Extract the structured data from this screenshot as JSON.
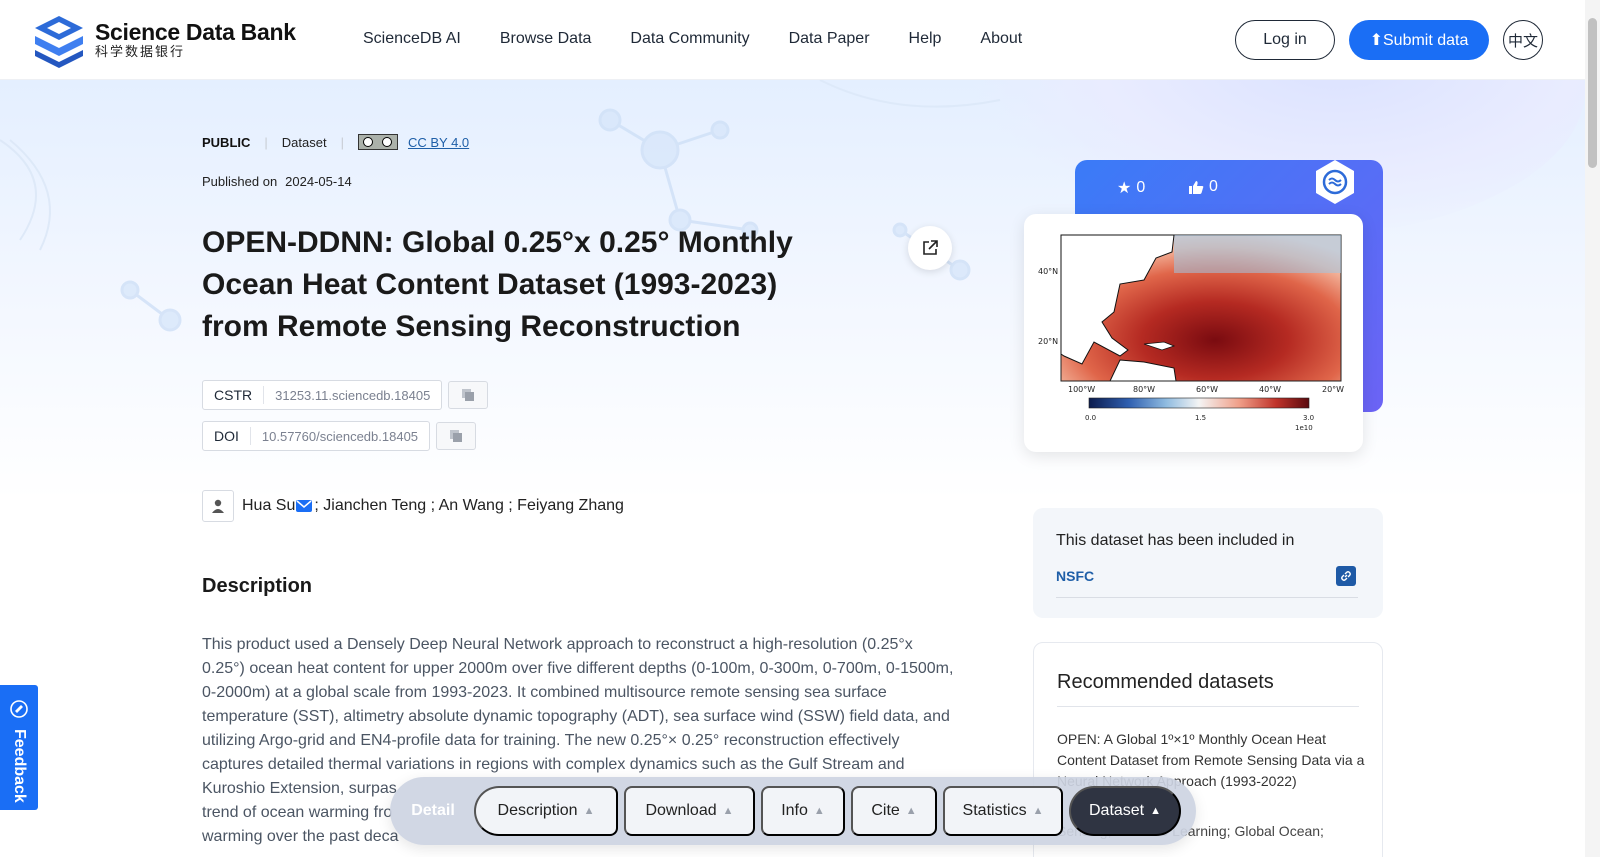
{
  "header": {
    "logo_en": "Science Data Bank",
    "logo_cn": "科学数据银行",
    "nav": [
      "ScienceDB AI",
      "Browse Data",
      "Data Community",
      "Data Paper",
      "Help",
      "About"
    ],
    "login_label": "Log in",
    "submit_label": "Submit data",
    "lang_label": "中文"
  },
  "meta": {
    "access": "PUBLIC",
    "type": "Dataset",
    "license": "CC BY 4.0",
    "published_label": "Published on",
    "published_date": "2024-05-14"
  },
  "dataset": {
    "title": "OPEN-DDNN: Global 0.25°x 0.25° Monthly Ocean Heat Content Dataset (1993-2023) from Remote Sensing Reconstruction",
    "cstr_label": "CSTR",
    "cstr_value": "31253.11.sciencedb.18405",
    "doi_label": "DOI",
    "doi_value": "10.57760/sciencedb.18405",
    "first_author": "Hua Su",
    "other_authors": "; Jianchen Teng ; An Wang ; Feiyang Zhang"
  },
  "description": {
    "heading": "Description",
    "text": "This product used a Densely Deep Neural Network approach to reconstruct a high-resolution (0.25°x 0.25°) ocean heat content for upper 2000m over five different depths (0-100m, 0-300m, 0-700m, 0-1500m, 0-2000m) at a global scale from 1993-2023. It combined multisource remote sensing sea surface temperature (SST), altimetry absolute dynamic topography (ADT), sea surface wind (SSW) field data, and utilizing Argo-grid and EN4-profile data for training. The new 0.25°× 0.25° reconstruction effectively captures detailed thermal variations in regions with complex dynamics such as the Gulf Stream and Kuroshio Extension, surpas",
    "line7": "trend of ocean warming fro",
    "line8": "warming over the past deca"
  },
  "stats": {
    "stars": "0",
    "likes": "0"
  },
  "preview_map": {
    "lat_labels": [
      "40°N",
      "20°N"
    ],
    "lon_labels": [
      "100°W",
      "80°W",
      "60°W",
      "40°W",
      "20°W"
    ],
    "colorbar_ticks": [
      "0.0",
      "1.5",
      "3.0"
    ],
    "colorbar_scale": "1e10"
  },
  "included": {
    "title": "This dataset has been included in",
    "item": "NSFC"
  },
  "recommended": {
    "title": "Recommended datasets",
    "item_title": "OPEN: A Global 1º×1º Monthly Ocean Heat Content Dataset from Remote Sensing Data via a Neural Network Approach (1993-2022)",
    "keywords": "Sensing; Machine Learning; Global Ocean;"
  },
  "feedback": {
    "label": "Feedback"
  },
  "detail_bar": {
    "label": "Detail",
    "tabs": [
      "Description",
      "Download",
      "Info",
      "Cite",
      "Statistics",
      "Dataset"
    ],
    "active_tab": "Dataset"
  },
  "colors": {
    "accent": "#1a6ef5",
    "link": "#1f5fa8",
    "active_tab": "#2f3442"
  }
}
